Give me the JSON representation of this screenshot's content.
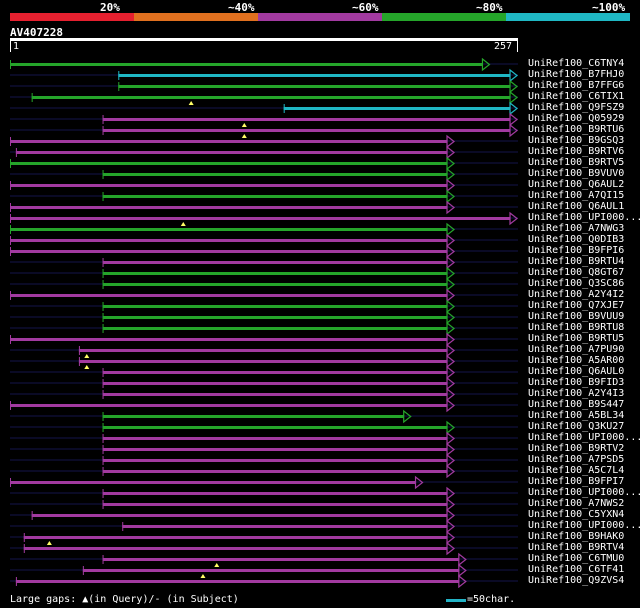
{
  "legend": [
    {
      "label": "20%",
      "color": "#e5202f"
    },
    {
      "label": "~40%",
      "color": "#e0701f"
    },
    {
      "label": "~60%",
      "color": "#a23aa0"
    },
    {
      "label": "~80%",
      "color": "#25a52a"
    },
    {
      "label": "~100%",
      "color": "#1fb7c4"
    }
  ],
  "query": {
    "name": "AV407228",
    "start": "1",
    "end": "257"
  },
  "hits": [
    {
      "name": "UniRef100_C6TNY4",
      "start": 1,
      "end": 244,
      "color": "green"
    },
    {
      "name": "UniRef100_B7FHJ0",
      "start": 56,
      "end": 258,
      "color": "cyan"
    },
    {
      "name": "UniRef100_B7FFG6",
      "start": 56,
      "end": 258,
      "color": "green"
    },
    {
      "name": "UniRef100_C6TIX1",
      "start": 12,
      "end": 258,
      "color": "green",
      "gap": 93
    },
    {
      "name": "UniRef100_Q9FSZ9",
      "start": 140,
      "end": 258,
      "color": "cyan"
    },
    {
      "name": "UniRef100_Q05929",
      "start": 48,
      "end": 258,
      "color": "purple",
      "gap": 120
    },
    {
      "name": "UniRef100_B9RTU6",
      "start": 48,
      "end": 258,
      "color": "purple",
      "gap": 120
    },
    {
      "name": "UniRef100_B9GSQ3",
      "start": 1,
      "end": 226,
      "color": "purple"
    },
    {
      "name": "UniRef100_B9RTV6",
      "start": 4,
      "end": 226,
      "color": "purple"
    },
    {
      "name": "UniRef100_B9RTV5",
      "start": 1,
      "end": 226,
      "color": "green"
    },
    {
      "name": "UniRef100_B9VUV0",
      "start": 48,
      "end": 226,
      "color": "green"
    },
    {
      "name": "UniRef100_Q6AUL2",
      "start": 1,
      "end": 226,
      "color": "purple"
    },
    {
      "name": "UniRef100_A7QI15",
      "start": 48,
      "end": 226,
      "color": "green"
    },
    {
      "name": "UniRef100_Q6AUL1",
      "start": 1,
      "end": 226,
      "color": "purple"
    },
    {
      "name": "UniRef100_UPI000...",
      "start": 1,
      "end": 258,
      "color": "purple",
      "gap": 89
    },
    {
      "name": "UniRef100_A7NWG3",
      "start": 1,
      "end": 226,
      "color": "green"
    },
    {
      "name": "UniRef100_Q0DIB3",
      "start": 1,
      "end": 226,
      "color": "purple"
    },
    {
      "name": "UniRef100_B9FPI6",
      "start": 1,
      "end": 226,
      "color": "purple"
    },
    {
      "name": "UniRef100_B9RTU4",
      "start": 48,
      "end": 226,
      "color": "purple"
    },
    {
      "name": "UniRef100_Q8GT67",
      "start": 48,
      "end": 226,
      "color": "green"
    },
    {
      "name": "UniRef100_Q3SC86",
      "start": 48,
      "end": 226,
      "color": "green"
    },
    {
      "name": "UniRef100_A2Y4I2",
      "start": 1,
      "end": 226,
      "color": "purple"
    },
    {
      "name": "UniRef100_Q7XJE7",
      "start": 48,
      "end": 226,
      "color": "green"
    },
    {
      "name": "UniRef100_B9VUU9",
      "start": 48,
      "end": 226,
      "color": "green"
    },
    {
      "name": "UniRef100_B9RTU8",
      "start": 48,
      "end": 226,
      "color": "green"
    },
    {
      "name": "UniRef100_B9RTU5",
      "start": 1,
      "end": 226,
      "color": "purple"
    },
    {
      "name": "UniRef100_A7PU90",
      "start": 36,
      "end": 226,
      "color": "purple",
      "gap": 40
    },
    {
      "name": "UniRef100_A5AR00",
      "start": 36,
      "end": 226,
      "color": "purple",
      "gap": 40
    },
    {
      "name": "UniRef100_Q6AUL0",
      "start": 48,
      "end": 226,
      "color": "purple"
    },
    {
      "name": "UniRef100_B9FID3",
      "start": 48,
      "end": 226,
      "color": "purple"
    },
    {
      "name": "UniRef100_A2Y4I3",
      "start": 48,
      "end": 226,
      "color": "purple"
    },
    {
      "name": "UniRef100_B9S447",
      "start": 1,
      "end": 226,
      "color": "purple"
    },
    {
      "name": "UniRef100_A5BL34",
      "start": 48,
      "end": 204,
      "color": "green"
    },
    {
      "name": "UniRef100_Q3KU27",
      "start": 48,
      "end": 226,
      "color": "green"
    },
    {
      "name": "UniRef100_UPI000...",
      "start": 48,
      "end": 226,
      "color": "purple"
    },
    {
      "name": "UniRef100_B9RTV2",
      "start": 48,
      "end": 226,
      "color": "purple"
    },
    {
      "name": "UniRef100_A7PSD5",
      "start": 48,
      "end": 226,
      "color": "purple"
    },
    {
      "name": "UniRef100_A5C7L4",
      "start": 48,
      "end": 226,
      "color": "purple"
    },
    {
      "name": "UniRef100_B9FPI7",
      "start": 1,
      "end": 210,
      "color": "purple"
    },
    {
      "name": "UniRef100_UPI000...",
      "start": 48,
      "end": 226,
      "color": "purple"
    },
    {
      "name": "UniRef100_A7NWS2",
      "start": 48,
      "end": 226,
      "color": "purple"
    },
    {
      "name": "UniRef100_C5YXN4",
      "start": 12,
      "end": 226,
      "color": "purple"
    },
    {
      "name": "UniRef100_UPI000...",
      "start": 58,
      "end": 226,
      "color": "purple"
    },
    {
      "name": "UniRef100_B9HAK0",
      "start": 8,
      "end": 226,
      "color": "purple",
      "gap": 21
    },
    {
      "name": "UniRef100_B9RTV4",
      "start": 8,
      "end": 226,
      "color": "purple"
    },
    {
      "name": "UniRef100_C6TMU0",
      "start": 48,
      "end": 232,
      "color": "purple",
      "gap": 106
    },
    {
      "name": "UniRef100_C6TF41",
      "start": 38,
      "end": 232,
      "color": "purple",
      "gap": 99
    },
    {
      "name": "UniRef100_Q9ZVS4",
      "start": 4,
      "end": 232,
      "color": "purple"
    }
  ],
  "footer": {
    "text": "Large gaps: ▲(in Query)/- (in Subject)",
    "scale": "=50char."
  },
  "colors": {
    "green": "#25a52a",
    "cyan": "#1fb7c4",
    "purple": "#a23aa0",
    "arrow_line": "#14144a"
  }
}
